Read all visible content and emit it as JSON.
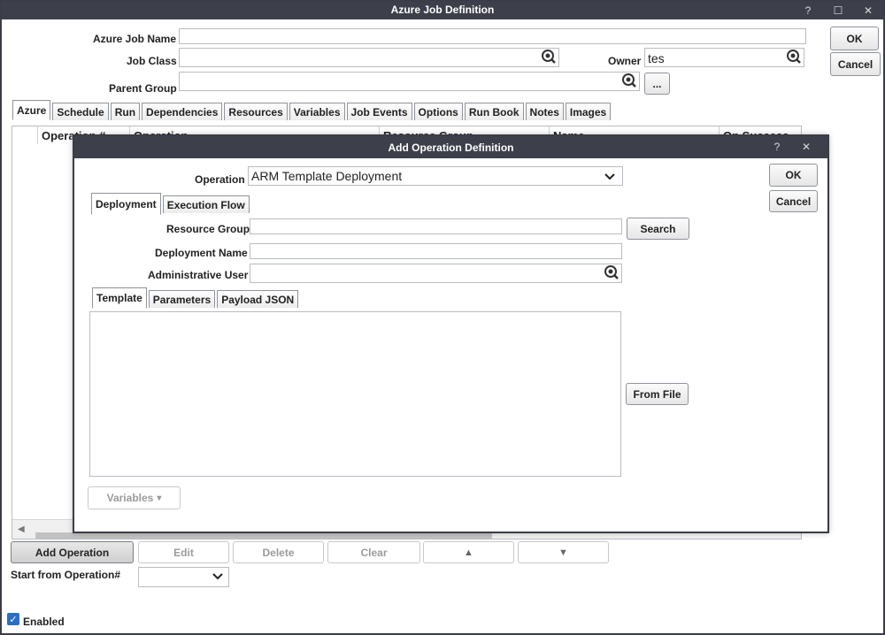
{
  "window": {
    "title": "Azure Job Definition",
    "help": "?",
    "maximize": "☐",
    "close": "✕"
  },
  "form": {
    "job_name_label": "Azure Job Name",
    "job_name_value": "",
    "job_class_label": "Job Class",
    "job_class_value": "",
    "owner_label": "Owner",
    "owner_value": "tes",
    "parent_group_label": "Parent Group",
    "parent_group_value": "",
    "browse_label": "...",
    "ok_label": "OK",
    "cancel_label": "Cancel"
  },
  "tabs": [
    "Azure",
    "Schedule",
    "Run",
    "Dependencies",
    "Resources",
    "Variables",
    "Job Events",
    "Options",
    "Run Book",
    "Notes",
    "Images"
  ],
  "grid": {
    "columns": [
      "Operation #",
      "Operation",
      "Resource Group",
      "Name",
      "On Success"
    ]
  },
  "actions": {
    "add": "Add Operation",
    "edit": "Edit",
    "delete": "Delete",
    "clear": "Clear",
    "up": "▲",
    "down": "▼",
    "start_from_label": "Start from Operation#",
    "start_from_value": "",
    "enabled_label": "Enabled",
    "enabled_checked": true
  },
  "dialog": {
    "title": "Add Operation Definition",
    "help": "?",
    "close": "✕",
    "operation_label": "Operation",
    "operation_value": "ARM Template Deployment",
    "ok_label": "OK",
    "cancel_label": "Cancel",
    "tabs": [
      "Deployment",
      "Execution Flow"
    ],
    "resource_group_label": "Resource Group",
    "resource_group_value": "",
    "search_label": "Search",
    "deployment_name_label": "Deployment Name",
    "deployment_name_value": "",
    "admin_user_label": "Administrative User",
    "admin_user_value": "",
    "inner_tabs": [
      "Template",
      "Parameters",
      "Payload JSON"
    ],
    "template_text": "",
    "from_file_label": "From File",
    "variables_label": "Variables",
    "variables_caret": "▾"
  }
}
